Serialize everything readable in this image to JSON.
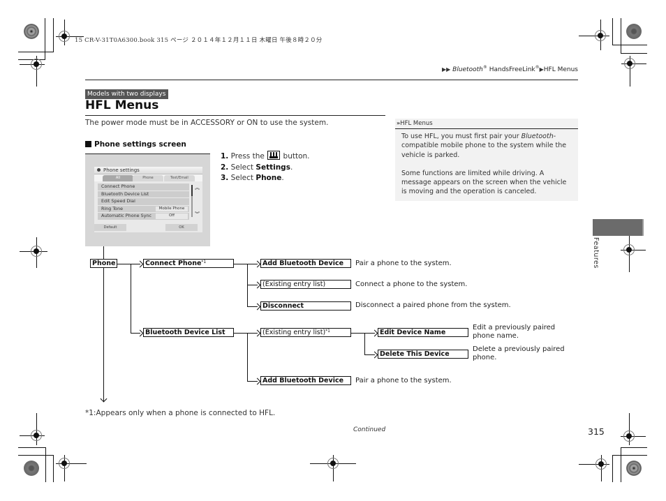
{
  "print_header": "15 CR-V-31T0A6300.book  315 ページ  ２０１４年１２月１１日  木曜日  午後８時２０分",
  "breadcrumb": {
    "arrow_icon": "▶▶",
    "part1": "Bluetooth",
    "reg1": "®",
    "part2": " HandsFreeLink",
    "reg2": "®",
    "arrow2_icon": "▶",
    "part3": "HFL Menus"
  },
  "badge": "Models with two displays",
  "title": "HFL Menus",
  "intro": "The power mode must be in ACCESSORY or ON to use the system.",
  "section_heading": "Phone settings screen",
  "steps": [
    {
      "num": "1.",
      "pre": "Press the",
      "post": "button.",
      "icon": "home-button-icon"
    },
    {
      "num": "2.",
      "pre": "Select",
      "bold": "Settings",
      "post": "."
    },
    {
      "num": "3.",
      "pre": "Select",
      "bold": "Phone",
      "post": "."
    }
  ],
  "note": {
    "heading_icon": "»",
    "heading": "HFL Menus",
    "para1_pre": "To use HFL, you must first pair your ",
    "para1_italic": "Bluetooth",
    "para1_post": "-compatible mobile phone to the system while the vehicle is parked.",
    "para2": "Some functions are limited while driving. A message appears on the screen when the vehicle is moving and the operation is canceled."
  },
  "screen": {
    "title": "Phone settings",
    "tabs": [
      "All",
      "Phone",
      "Text/Email"
    ],
    "active_tab": "All",
    "rows": [
      {
        "label": "Connect Phone",
        "value": ""
      },
      {
        "label": "Bluetooth Device List",
        "value": ""
      },
      {
        "label": "Edit Speed Dial",
        "value": ""
      },
      {
        "label": "Ring Tone",
        "value": "Mobile Phone"
      },
      {
        "label": "Automatic Phone Sync",
        "value": "Off"
      }
    ],
    "scroll_up_icon": "︽",
    "scroll_down_icon": "︾",
    "default_button": "Default",
    "ok_button": "OK"
  },
  "diagram": {
    "root": "Phone",
    "connect_phone": "Connect Phone",
    "connect_phone_sup": "*1",
    "add_bt_device_1": "Add Bluetooth Device",
    "add_bt_device_1_desc": "Pair a phone to the system.",
    "existing_list_1": "(Existing entry list)",
    "existing_list_1_desc": "Connect a phone to the system.",
    "disconnect": "Disconnect",
    "disconnect_desc": "Disconnect a paired phone from the system.",
    "bt_device_list": "Bluetooth Device List",
    "existing_list_2": "(Existing entry list)",
    "existing_list_2_sup": "*1",
    "edit_device_name": "Edit Device Name",
    "edit_device_name_desc_1": "Edit a previously paired",
    "edit_device_name_desc_2": "phone name.",
    "delete_device": "Delete This Device",
    "delete_device_desc_1": "Delete a previously paired",
    "delete_device_desc_2": "phone.",
    "add_bt_device_2": "Add Bluetooth Device",
    "add_bt_device_2_desc": "Pair a phone to the system."
  },
  "footnote": "*1:Appears only when a phone is connected to HFL.",
  "continued": "Continued",
  "page_number": "315",
  "side_tab_label": "Features"
}
